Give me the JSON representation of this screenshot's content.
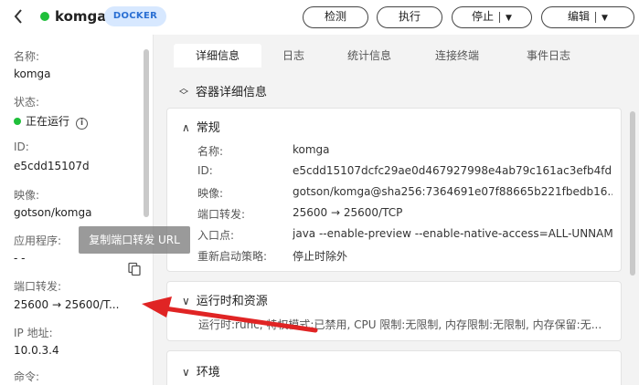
{
  "header": {
    "app_name": "komga",
    "badge": "DOCKER",
    "buttons": {
      "detect": "检测",
      "execute": "执行",
      "stop": "停止",
      "edit": "编辑"
    }
  },
  "left": {
    "name_label": "名称:",
    "name_value": "komga",
    "status_label": "状态:",
    "status_value": "正在运行",
    "id_label": "ID:",
    "id_value": "e5cdd15107d",
    "image_label": "映像:",
    "image_value": "gotson/komga",
    "app_label": "应用程序:",
    "app_value": "- -",
    "port_label": "端口转发:",
    "port_value": "25600 → 25600/T...",
    "ip_label": "IP 地址:",
    "ip_value": "10.0.3.4",
    "cmd_label": "命令:",
    "tooltip": "复制端口转发 URL"
  },
  "tabs": [
    "详细信息",
    "日志",
    "统计信息",
    "连接终端",
    "事件日志"
  ],
  "section_title": "容器详细信息",
  "general": {
    "title": "常规",
    "rows": [
      {
        "k": "名称:",
        "v": "komga"
      },
      {
        "k": "ID:",
        "v": "e5cdd15107dcfc29ae0d467927998e4ab79c161ac3efb4fd..."
      },
      {
        "k": "映像:",
        "v": "gotson/komga@sha256:7364691e07f88665b221fbedb16..."
      },
      {
        "k": "端口转发:",
        "v": "25600 → 25600/TCP"
      },
      {
        "k": "入口点:",
        "v": "java --enable-preview --enable-native-access=ALL-UNNAME..."
      },
      {
        "k": "重新启动策略:",
        "v": "停止时除外"
      }
    ]
  },
  "runtime": {
    "title": "运行时和资源",
    "summary": "运行时:runc, 特权模式:已禁用, CPU 限制:无限制, 内存限制:无限制, 内存保留:无..."
  },
  "env": {
    "title": "环境"
  },
  "icons": {
    "back": "chevron-left-icon",
    "copy": "copy-icon",
    "info": "info-icon"
  },
  "colors": {
    "running": "#1fbf3a",
    "badge_bg": "#d7e8ff",
    "badge_text": "#2a6fd3",
    "arrow": "#e02424"
  }
}
